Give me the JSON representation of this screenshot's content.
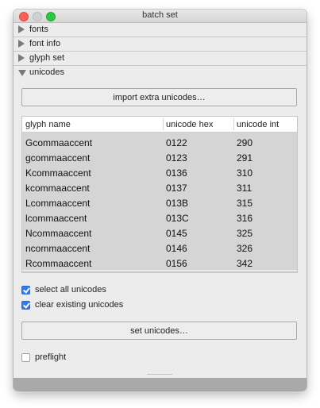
{
  "window": {
    "title": "batch set"
  },
  "sections": [
    {
      "label": "fonts",
      "expanded": false
    },
    {
      "label": "font info",
      "expanded": false
    },
    {
      "label": "glyph set",
      "expanded": false
    },
    {
      "label": "unicodes",
      "expanded": true
    }
  ],
  "unicodes": {
    "import_button": "import extra unicodes…",
    "table": {
      "headers": [
        "glyph name",
        "unicode hex",
        "unicode int"
      ],
      "rows": [
        [
          "Gcommaaccent",
          "0122",
          "290"
        ],
        [
          "gcommaaccent",
          "0123",
          "291"
        ],
        [
          "Kcommaaccent",
          "0136",
          "310"
        ],
        [
          "kcommaaccent",
          "0137",
          "311"
        ],
        [
          "Lcommaaccent",
          "013B",
          "315"
        ],
        [
          "lcommaaccent",
          "013C",
          "316"
        ],
        [
          "Ncommaaccent",
          "0145",
          "325"
        ],
        [
          "ncommaaccent",
          "0146",
          "326"
        ],
        [
          "Rcommaaccent",
          "0156",
          "342"
        ]
      ]
    },
    "select_all": {
      "label": "select all unicodes",
      "checked": true
    },
    "clear_existing": {
      "label": "clear existing unicodes",
      "checked": true
    },
    "set_button": "set unicodes…",
    "preflight": {
      "label": "preflight",
      "checked": false
    }
  }
}
